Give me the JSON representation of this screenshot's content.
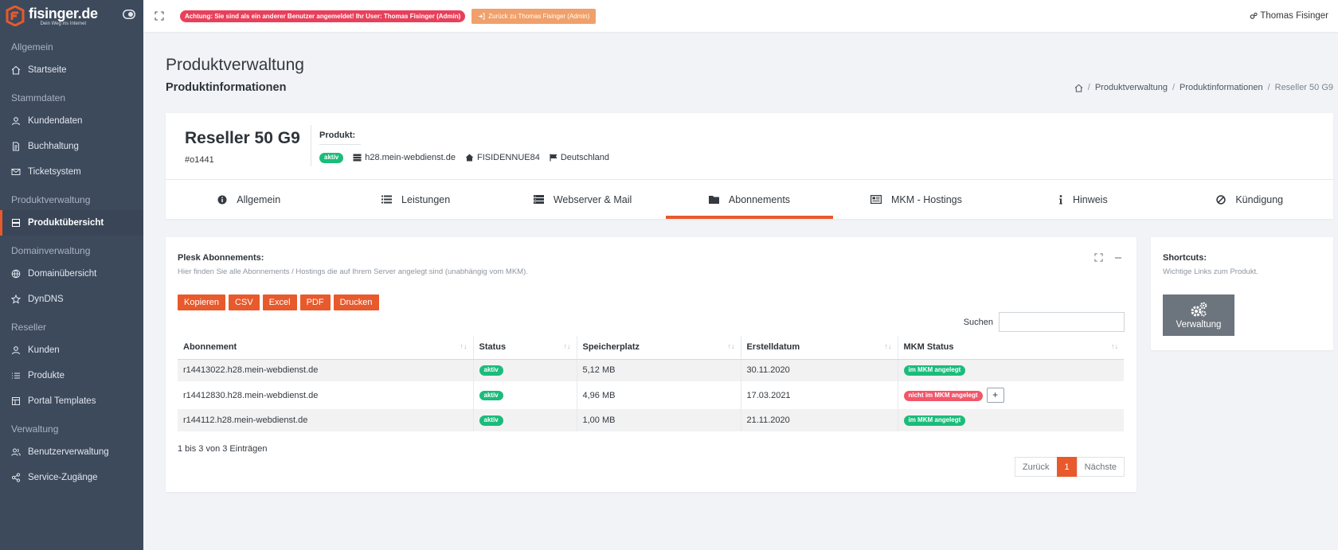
{
  "brand": {
    "name": "fisinger.de",
    "tagline": "Dein Weg ins Internet"
  },
  "colors": {
    "accent": "#e8592c",
    "sidebar": "#3d4a5c",
    "success": "#1bbc7b",
    "danger": "#f0576a"
  },
  "sidebar": {
    "sections": [
      {
        "title": "Allgemein",
        "items": [
          {
            "label": "Startseite",
            "icon": "home-icon"
          }
        ]
      },
      {
        "title": "Stammdaten",
        "items": [
          {
            "label": "Kundendaten",
            "icon": "user-icon"
          },
          {
            "label": "Buchhaltung",
            "icon": "file-icon"
          },
          {
            "label": "Ticketsystem",
            "icon": "mail-icon"
          }
        ]
      },
      {
        "title": "Produktverwaltung",
        "items": [
          {
            "label": "Produktübersicht",
            "icon": "server-icon",
            "active": true
          }
        ]
      },
      {
        "title": "Domainverwaltung",
        "items": [
          {
            "label": "Domainübersicht",
            "icon": "globe-icon"
          },
          {
            "label": "DynDNS",
            "icon": "star-icon"
          }
        ]
      },
      {
        "title": "Reseller",
        "items": [
          {
            "label": "Kunden",
            "icon": "user-icon"
          },
          {
            "label": "Produkte",
            "icon": "list-icon"
          },
          {
            "label": "Portal Templates",
            "icon": "layout-icon"
          }
        ]
      },
      {
        "title": "Verwaltung",
        "items": [
          {
            "label": "Benutzerverwaltung",
            "icon": "users-icon"
          },
          {
            "label": "Service-Zugänge",
            "icon": "share-icon"
          }
        ]
      }
    ]
  },
  "topbar": {
    "warning": "Achtung: Sie sind als ein anderer Benutzer angemeldet! Ihr User: Thomas Fisinger (Admin)",
    "back_button": "Zurück zu Thomas Fisinger (Admin)",
    "user": "Thomas Fisinger"
  },
  "page": {
    "title": "Produktverwaltung",
    "subtitle": "Produktinformationen"
  },
  "breadcrumb": {
    "items": [
      "Produktverwaltung",
      "Produktinformationen"
    ],
    "current": "Reseller 50 G9"
  },
  "product": {
    "name": "Reseller 50 G9",
    "id": "#o1441",
    "label": "Produkt:",
    "status": "aktiv",
    "server": "h28.mein-webdienst.de",
    "customer": "FISIDENNUE84",
    "country": "Deutschland"
  },
  "tabs": [
    {
      "label": "Allgemein",
      "icon": "info-circle-icon"
    },
    {
      "label": "Leistungen",
      "icon": "list-icon"
    },
    {
      "label": "Webserver & Mail",
      "icon": "server-icon"
    },
    {
      "label": "Abonnements",
      "icon": "folder-icon",
      "active": true
    },
    {
      "label": "MKM - Hostings",
      "icon": "newspaper-icon"
    },
    {
      "label": "Hinweis",
      "icon": "info-icon"
    },
    {
      "label": "Kündigung",
      "icon": "ban-icon"
    }
  ],
  "subscriptions": {
    "title": "Plesk Abonnements:",
    "description": "Hier finden Sie alle Abonnements / Hostings die auf Ihrem Server angelegt sind (unabhängig vom MKM).",
    "buttons": [
      "Kopieren",
      "CSV",
      "Excel",
      "PDF",
      "Drucken"
    ],
    "search_label": "Suchen",
    "columns": [
      "Abonnement",
      "Status",
      "Speicherplatz",
      "Erstelldatum",
      "MKM Status"
    ],
    "rows": [
      {
        "name": "r14413022.h28.mein-webdienst.de",
        "status": "aktiv",
        "storage": "5,12 MB",
        "created": "30.11.2020",
        "mkm": "im MKM angelegt",
        "mkm_ok": true
      },
      {
        "name": "r14412830.h28.mein-webdienst.de",
        "status": "aktiv",
        "storage": "4,96 MB",
        "created": "17.03.2021",
        "mkm": "nicht im MKM angelegt",
        "mkm_ok": false
      },
      {
        "name": "r144112.h28.mein-webdienst.de",
        "status": "aktiv",
        "storage": "1,00 MB",
        "created": "21.11.2020",
        "mkm": "im MKM angelegt",
        "mkm_ok": true
      }
    ],
    "info": "1 bis 3 von 3 Einträgen",
    "pager": {
      "prev": "Zurück",
      "page": "1",
      "next": "Nächste"
    },
    "add_label": "+"
  },
  "shortcuts": {
    "title": "Shortcuts:",
    "description": "Wichtige Links zum Produkt.",
    "button": "Verwaltung"
  }
}
